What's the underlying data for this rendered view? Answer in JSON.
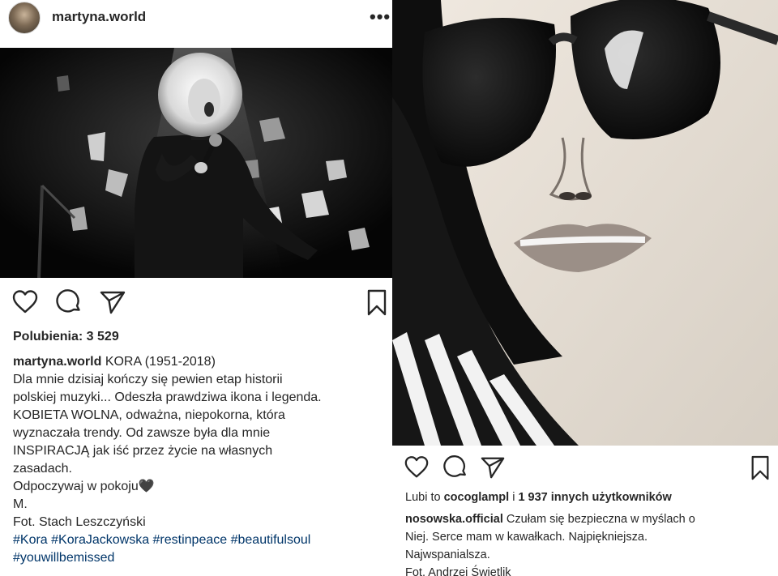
{
  "left_post": {
    "username": "martyna.world",
    "likes_label": "Polubienia: 3 529",
    "caption": {
      "username": "martyna.world",
      "title": "KORA (1951-2018)",
      "lines": [
        "Dla mnie dzisiaj kończy się pewien etap historii",
        "polskiej muzyki... Odeszła prawdziwa ikona i legenda.",
        "KOBIETA WOLNA, odważna, niepokorna, która",
        "wyznaczała trendy. Od zawsze była dla mnie",
        "INSPIRACJĄ jak iść przez życie na własnych",
        "zasadach."
      ],
      "rest_in_peace": "Odpoczywaj w pokoju🖤",
      "signature": "M.",
      "photo_credit": "Fot. Stach Leszczyński",
      "hashtags_line1": "#Kora #KoraJackowska #restinpeace #beautifulsoul",
      "hashtags_line2": "#youwillbemissed"
    }
  },
  "right_post": {
    "likes_prefix": "Lubi to",
    "likes_user": "cocoglampl",
    "likes_middle": "i",
    "likes_count": "1 937 innych użytkowników",
    "caption": {
      "username": "nosowska.official",
      "first_line": "Czułam się bezpieczna w myślach o",
      "line2": "Niej. Serce mam w kawałkach. Najpiękniejsza.",
      "line3": "Najwspanialsza.",
      "photo_credit": "Fot. Andrzej Świetlik"
    }
  },
  "icons": {
    "like": "heart-outline",
    "comment": "speech-bubble-outline",
    "share": "paper-plane-outline",
    "save": "bookmark-outline",
    "more": "three-dots-horizontal"
  }
}
